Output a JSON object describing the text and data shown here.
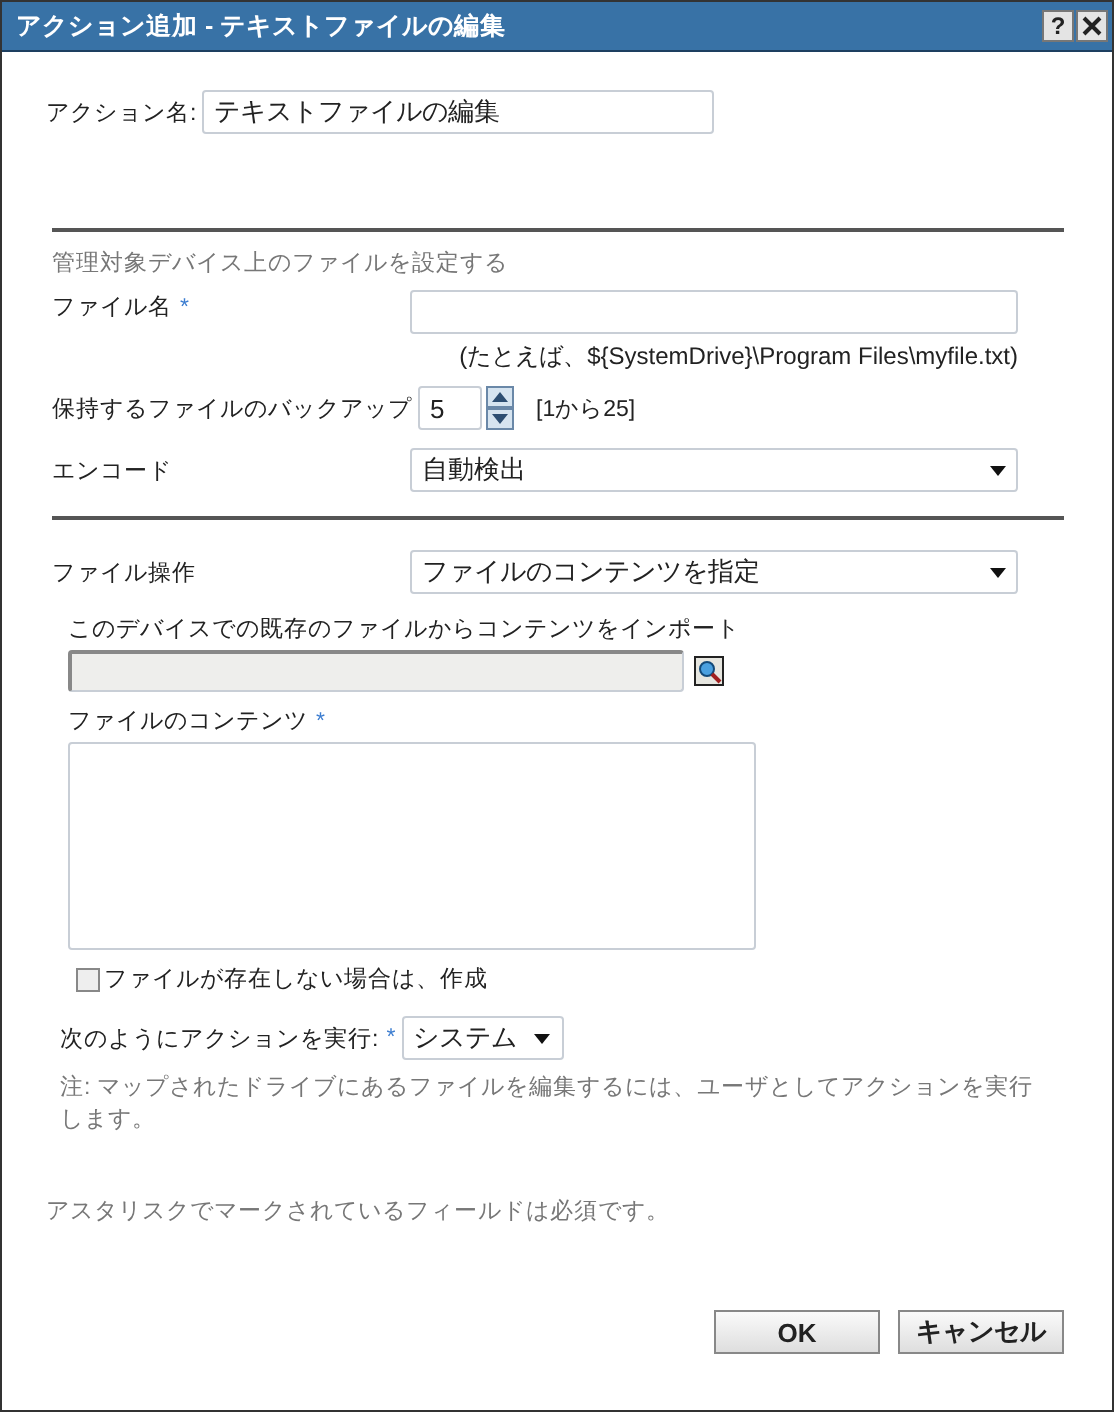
{
  "window": {
    "title": "アクション追加 - テキストファイルの編集",
    "help": "?"
  },
  "required_marker": "*",
  "action_name": {
    "label": "アクション名:",
    "value": "テキストファイルの編集"
  },
  "section_title": "管理対象デバイス上のファイルを設定する",
  "file_name": {
    "label": "ファイル名",
    "required": true,
    "value_hint": "(たとえば、${SystemDrive}\\Program Files\\myfile.txt)"
  },
  "backups": {
    "label": "保持するファイルのバックアップ",
    "value": "5",
    "range": "[1から25]"
  },
  "encoding": {
    "label": "エンコード",
    "value": "自動検出"
  },
  "file_operation": {
    "label": "ファイル操作",
    "value": "ファイルのコンテンツを指定"
  },
  "import": {
    "label": "このデバイスでの既存のファイルからコンテンツをインポート",
    "disabled": true
  },
  "contents": {
    "label": "ファイルのコンテンツ",
    "required": true
  },
  "create_if_missing": {
    "label": "ファイルが存在しない場合は、作成",
    "checked": false
  },
  "run_as": {
    "label": "次のようにアクションを実行:",
    "required": true,
    "value": "システム"
  },
  "note": "注: マップされたドライブにあるファイルを編集するには、ユーザとしてアクションを実行します。",
  "footnote": "アスタリスクでマークされているフィールドは必須です。",
  "buttons": [
    "OK",
    "キャンセル"
  ]
}
